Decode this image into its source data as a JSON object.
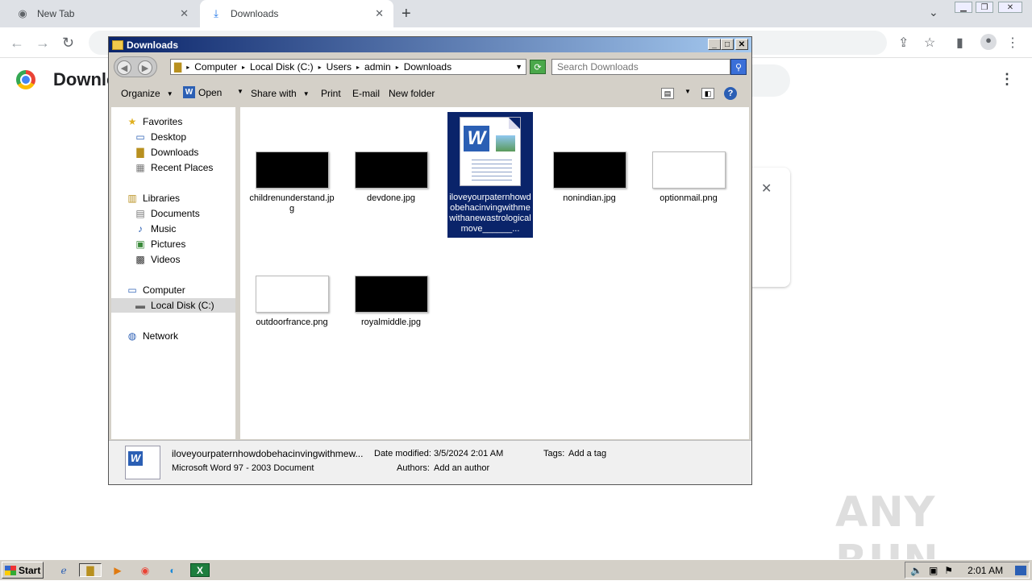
{
  "browser": {
    "tabs": [
      {
        "label": "New Tab",
        "icon": "chrome-icon"
      },
      {
        "label": "Downloads",
        "icon": "download-icon"
      }
    ],
    "page_title": "Downloads"
  },
  "explorer": {
    "title": "Downloads",
    "breadcrumb": [
      "Computer",
      "Local Disk (C:)",
      "Users",
      "admin",
      "Downloads"
    ],
    "search_placeholder": "Search Downloads",
    "commands": {
      "organize": "Organize",
      "open": "Open",
      "share_with": "Share with",
      "print": "Print",
      "email": "E-mail",
      "new_folder": "New folder"
    },
    "nav": {
      "favorites": "Favorites",
      "desktop": "Desktop",
      "downloads": "Downloads",
      "recent_places": "Recent Places",
      "libraries": "Libraries",
      "documents": "Documents",
      "music": "Music",
      "pictures": "Pictures",
      "videos": "Videos",
      "computer": "Computer",
      "local_disk": "Local Disk (C:)",
      "network": "Network"
    },
    "files": [
      {
        "name": "childrenunderstand.jpg",
        "thumb": "black"
      },
      {
        "name": "devdone.jpg",
        "thumb": "black"
      },
      {
        "name": "iloveyourpaternhowdobehacinvingwithmewithanewastrologicalmove______...",
        "thumb": "word"
      },
      {
        "name": "nonindian.jpg",
        "thumb": "black"
      },
      {
        "name": "optionmail.png",
        "thumb": "white"
      },
      {
        "name": "outdoorfrance.png",
        "thumb": "white"
      },
      {
        "name": "royalmiddle.jpg",
        "thumb": "black"
      }
    ],
    "details": {
      "file_name": "iloveyourpaternhowdobehacinvingwithmew...",
      "file_type": "Microsoft Word 97 - 2003 Document",
      "date_modified_label": "Date modified:",
      "date_modified": "3/5/2024 2:01 AM",
      "tags_label": "Tags:",
      "tags_value": "Add a tag",
      "authors_label": "Authors:",
      "authors_value": "Add an author"
    }
  },
  "taskbar": {
    "start": "Start",
    "time": "2:01 AM"
  },
  "watermark": "ANY RUN"
}
